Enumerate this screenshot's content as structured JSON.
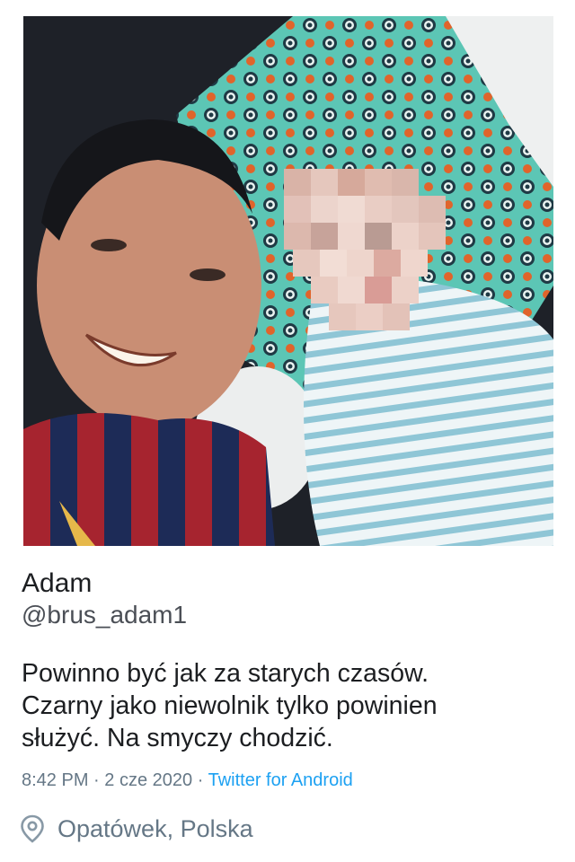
{
  "tweet": {
    "display_name": "Adam",
    "handle": "@brus_adam1",
    "text_lines": [
      "Powinno być jak za starych czasów.",
      "Czarny jako niewolnik tylko powinien",
      "służyć. Na smyczy chodzić."
    ],
    "time": "8:42 PM",
    "separator": "·",
    "date": "2 cze 2020",
    "source": "Twitter for Android",
    "location": "Opatówek, Polska"
  },
  "icons": {
    "location": "location-pin-icon"
  },
  "colors": {
    "text_primary": "#1c1e21",
    "text_secondary": "#657786",
    "link": "#1da1f2",
    "background": "#ffffff"
  }
}
